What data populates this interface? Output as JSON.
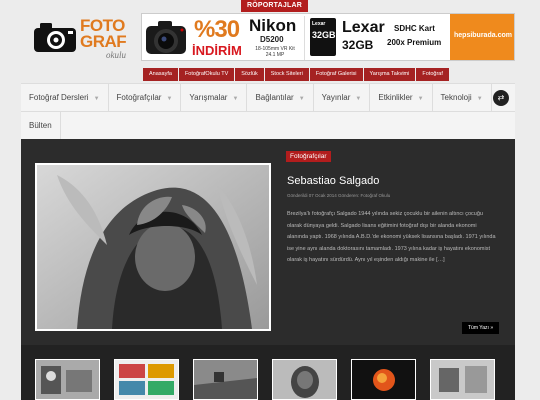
{
  "header": {
    "top_tag": "RÖPORTAJLAR",
    "logo": {
      "line1": "FOTO",
      "line2": "GRAF",
      "line3": "okulu"
    }
  },
  "banner": {
    "percent": "%30",
    "discount_word": "İNDİRİM",
    "nikon_brand": "Nikon",
    "nikon_model": "D5200",
    "nikon_spec_1": "18-105mm VR Kit",
    "nikon_spec_2": "24.1 MP",
    "sd_brand": "Lexar",
    "sd_capacity": "32GB",
    "lexar_brand": "Lexar",
    "lexar_capacity": "32GB",
    "sdhc": "SDHC Kart",
    "speed": "200x Premium",
    "store": "hepsiburada.com"
  },
  "subnav": [
    "Anasayfa",
    "FotoğrafOkulu TV",
    "Sözlük",
    "Stock Siteleri",
    "Fotoğraf Galerisi",
    "Yarışma Takvimi",
    "Fotoğraf"
  ],
  "mainnav": {
    "row1": [
      "Fotoğraf Dersleri",
      "Fotoğrafçılar",
      "Yarışmalar",
      "Bağlantılar",
      "Yayınlar",
      "Etkinlikler",
      "Teknoloji"
    ],
    "row2": [
      "Bülten"
    ]
  },
  "featured": {
    "category": "Fotoğrafçılar",
    "title": "Sebastiao Salgado",
    "meta": "Gönderildi 07 Ocak 2014 Gönderen: Fotoğraf Okulu",
    "excerpt": "Brezilya’lı fotoğrafçı Salgado 1944 yılında sekiz çocuklu bir ailenin altıncı çocuğu olarak dünyaya geldi. Salgado lisans eğitimini fotoğraf dışı bir alanda ekonomi alanında yaptı. 1968 yılında A.B.D.’de ekonomi yüksek lisansına başladı. 1971 yılında ise yine aynı alanda doktorasını tamamladı. 1973 yılına kadar iş hayatını ekonomist olarak iş hayatını sürdürdü. Aynı yıl eşinden aldığı makine ile […]",
    "read_more": "Tüm Yazı »"
  },
  "colors": {
    "accent": "#b21d1d",
    "dark": "#2c2c2c",
    "orange": "#e07a1f"
  }
}
